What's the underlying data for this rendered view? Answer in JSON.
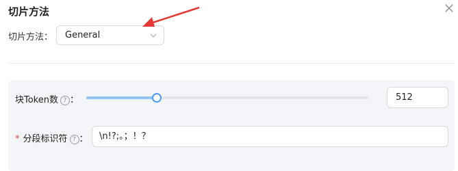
{
  "dialog": {
    "title": "切片方法",
    "close_icon": "close-icon"
  },
  "chunk_method": {
    "label": "切片方法：",
    "selected": "General",
    "icon": "chevron-down-icon"
  },
  "token_row": {
    "label": "块Token数",
    "help_icon": "question-circle-icon",
    "help_glyph": "?",
    "colon": "：",
    "slider_fraction": 0.25,
    "value": "512"
  },
  "delimiter_row": {
    "required_mark": "*",
    "label": "分段标识符",
    "help_icon": "question-circle-icon",
    "help_glyph": "?",
    "colon": "：",
    "value": "\\n!?;。；！？"
  },
  "colors": {
    "annotation_arrow": "#e53935",
    "slider_fill": "#8fc3f7",
    "slider_handle": "#4a9cf4",
    "required": "#e5484d"
  }
}
